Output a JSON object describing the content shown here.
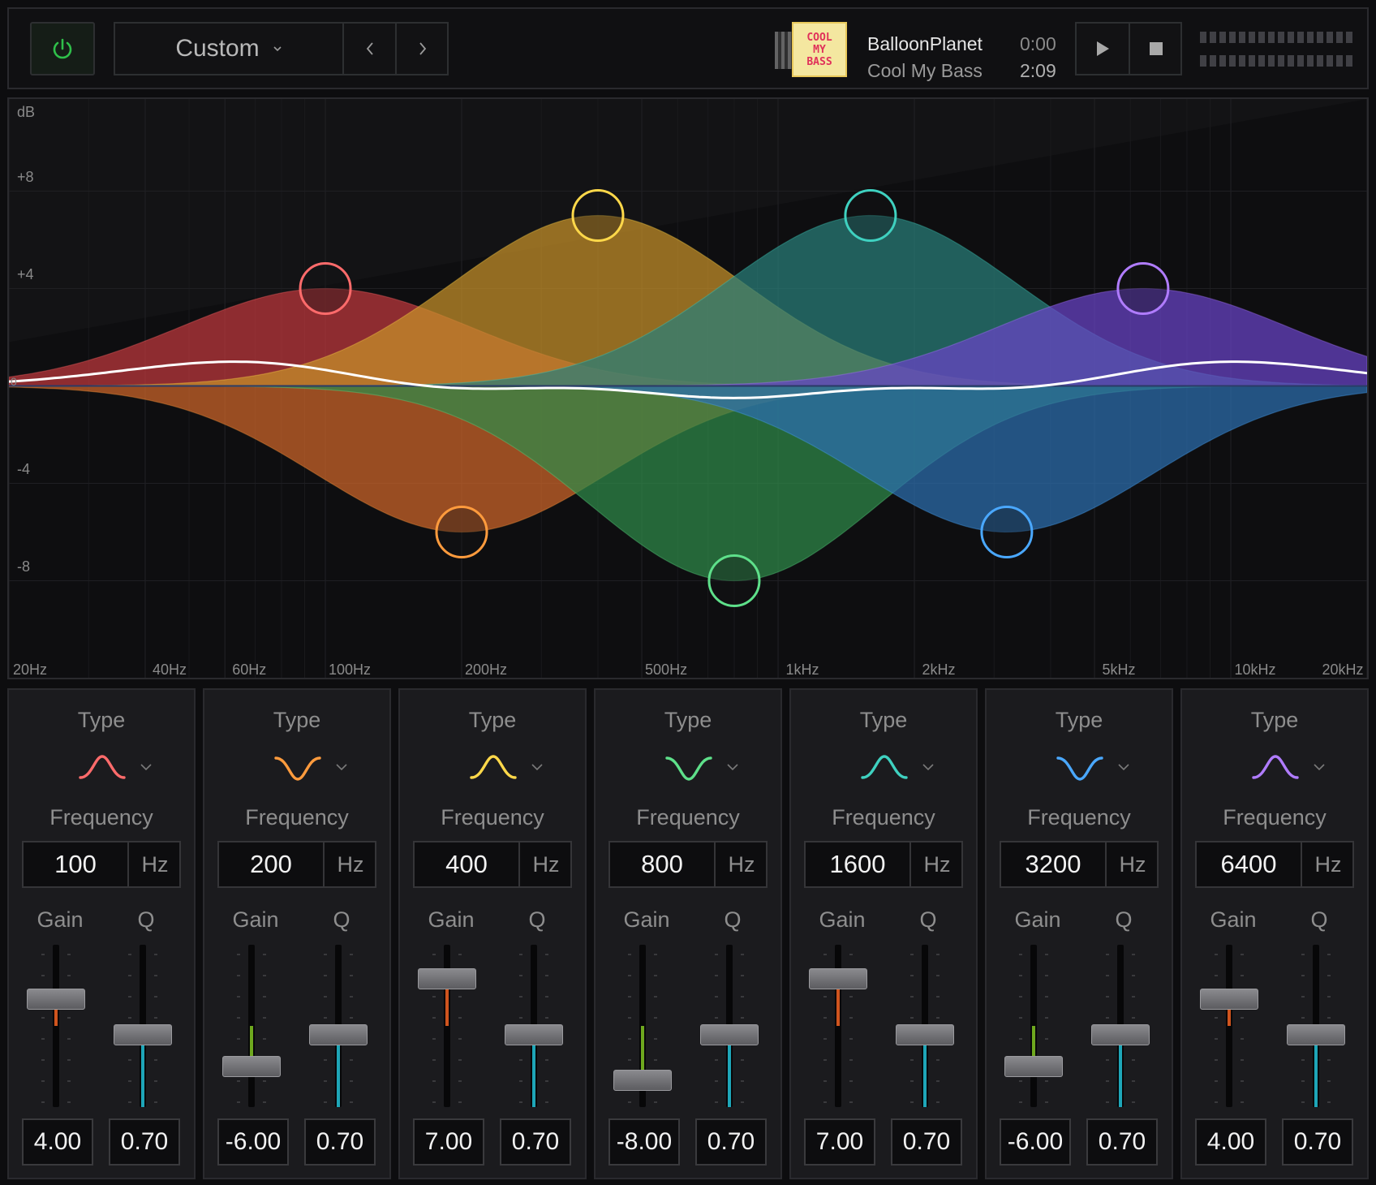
{
  "toolbar": {
    "preset_label": "Custom",
    "power_color": "#2fbf4a"
  },
  "now_playing": {
    "album_art_lines": [
      "COOL",
      "MY",
      "BASS"
    ],
    "artist": "BalloonPlanet",
    "track": "Cool My Bass",
    "time_current": "0:00",
    "time_total": "2:09"
  },
  "graph": {
    "y_axis_label": "dB",
    "y_ticks": [
      {
        "value": 8,
        "label": "+8"
      },
      {
        "value": 4,
        "label": "+4"
      },
      {
        "value": 0,
        "label": "0"
      },
      {
        "value": -4,
        "label": "-4"
      },
      {
        "value": -8,
        "label": "-8"
      }
    ],
    "x_ticks": [
      {
        "freq": 20,
        "label": "20Hz"
      },
      {
        "freq": 40,
        "label": "40Hz"
      },
      {
        "freq": 60,
        "label": "60Hz"
      },
      {
        "freq": 100,
        "label": "100Hz"
      },
      {
        "freq": 200,
        "label": "200Hz"
      },
      {
        "freq": 500,
        "label": "500Hz"
      },
      {
        "freq": 1000,
        "label": "1kHz"
      },
      {
        "freq": 2000,
        "label": "2kHz"
      },
      {
        "freq": 5000,
        "label": "5kHz"
      },
      {
        "freq": 10000,
        "label": "10kHz"
      },
      {
        "freq": 20000,
        "label": "20kHz"
      }
    ],
    "db_range": [
      -12,
      12
    ],
    "freq_range": [
      20,
      20000
    ]
  },
  "band_labels": {
    "type": "Type",
    "frequency": "Frequency",
    "unit": "Hz",
    "gain": "Gain",
    "q": "Q"
  },
  "bands": [
    {
      "type": "peak",
      "frequency": "100",
      "gain": "4.00",
      "q": "0.70",
      "freq_num": 100,
      "gain_num": 4,
      "color": "#ff6b6b",
      "fill": "#c0393d"
    },
    {
      "type": "notch",
      "frequency": "200",
      "gain": "-6.00",
      "q": "0.70",
      "freq_num": 200,
      "gain_num": -6,
      "color": "#ff9b3d",
      "fill": "#d0662a"
    },
    {
      "type": "peak",
      "frequency": "400",
      "gain": "7.00",
      "q": "0.70",
      "freq_num": 400,
      "gain_num": 7,
      "color": "#ffd84a",
      "fill": "#c8922a"
    },
    {
      "type": "notch",
      "frequency": "800",
      "gain": "-8.00",
      "q": "0.70",
      "freq_num": 800,
      "gain_num": -8,
      "color": "#5ee08a",
      "fill": "#2f8a4a"
    },
    {
      "type": "peak",
      "frequency": "1600",
      "gain": "7.00",
      "q": "0.70",
      "freq_num": 1600,
      "gain_num": 7,
      "color": "#3fd1c0",
      "fill": "#2a7f7a"
    },
    {
      "type": "notch",
      "frequency": "3200",
      "gain": "-6.00",
      "q": "0.70",
      "freq_num": 3200,
      "gain_num": -6,
      "color": "#4aa8ff",
      "fill": "#2c6fae"
    },
    {
      "type": "peak",
      "frequency": "6400",
      "gain": "4.00",
      "q": "0.70",
      "freq_num": 6400,
      "gain_num": 4,
      "color": "#b07cff",
      "fill": "#6a44c8"
    }
  ]
}
